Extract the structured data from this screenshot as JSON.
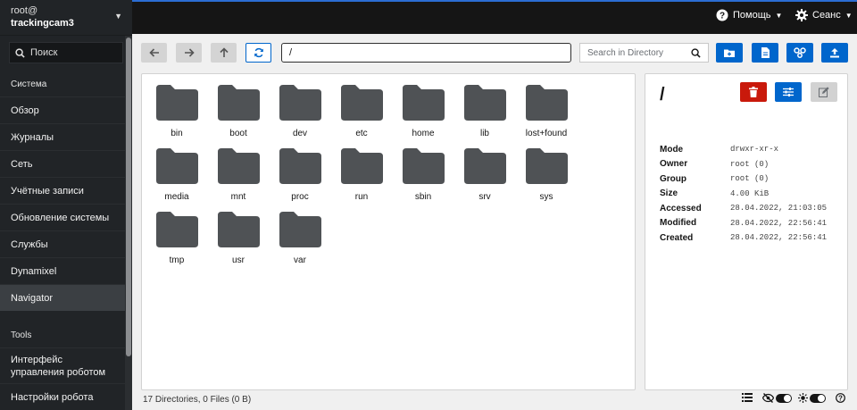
{
  "sidebar": {
    "user": "root@",
    "host": "trackingcam3",
    "search_label": "Поиск",
    "group_system": "Система",
    "items": [
      "Обзор",
      "Журналы",
      "Сеть",
      "Учётные записи",
      "Обновление системы",
      "Службы",
      "Dynamixel",
      "Navigator"
    ],
    "group_tools": "Tools",
    "tools": [
      {
        "line1": "Интерфейс",
        "line2": "управления роботом"
      },
      {
        "line1": "Настройки робота",
        "line2": ""
      }
    ]
  },
  "topbar": {
    "help_label": "Помощь",
    "session_label": "Сеанс"
  },
  "toolbar": {
    "path_value": "/",
    "search_placeholder": "Search in Directory"
  },
  "folders": [
    "bin",
    "boot",
    "dev",
    "etc",
    "home",
    "lib",
    "lost+found",
    "media",
    "mnt",
    "proc",
    "run",
    "sbin",
    "srv",
    "sys",
    "tmp",
    "usr",
    "var"
  ],
  "details": {
    "title": "/",
    "properties": [
      {
        "key": "Mode",
        "value": "drwxr-xr-x"
      },
      {
        "key": "Owner",
        "value": "root (0)"
      },
      {
        "key": "Group",
        "value": "root (0)"
      },
      {
        "key": "Size",
        "value": "4.00 KiB"
      },
      {
        "key": "Accessed",
        "value": "28.04.2022, 21:03:05"
      },
      {
        "key": "Modified",
        "value": "28.04.2022, 22:56:41"
      },
      {
        "key": "Created",
        "value": "28.04.2022, 22:56:41"
      }
    ]
  },
  "status": {
    "summary": "17 Directories, 0 Files (0 B)"
  },
  "colors": {
    "accent": "#0066cc",
    "danger": "#c9190b",
    "sidebar": "#212427",
    "topbar": "#151515",
    "folder": "#4f5255"
  }
}
